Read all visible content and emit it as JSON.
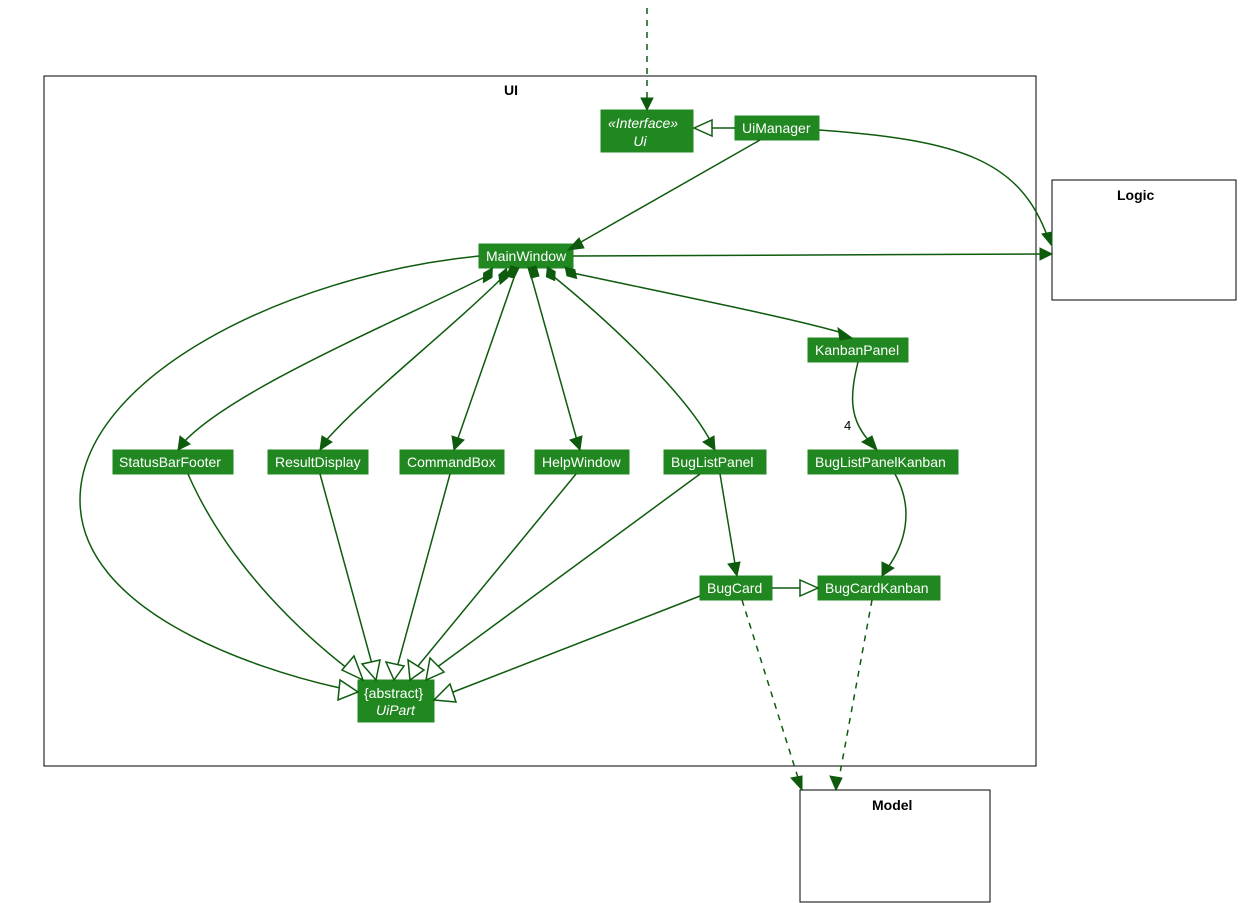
{
  "packages": {
    "ui": "UI",
    "logic": "Logic",
    "model": "Model"
  },
  "classes": {
    "interface_stereo": "«Interface»",
    "interface_name": "Ui",
    "uiManager": "UiManager",
    "mainWindow": "MainWindow",
    "kanbanPanel": "KanbanPanel",
    "statusBarFooter": "StatusBarFooter",
    "resultDisplay": "ResultDisplay",
    "commandBox": "CommandBox",
    "helpWindow": "HelpWindow",
    "bugListPanel": "BugListPanel",
    "bugListPanelKanban": "BugListPanelKanban",
    "bugCard": "BugCard",
    "bugCardKanban": "BugCardKanban",
    "abstract_stereo": "{abstract}",
    "uiPart": "UiPart"
  },
  "multiplicity": {
    "four": "4"
  },
  "colors": {
    "box_fill": "#218721",
    "edge": "#0e5b0e"
  }
}
